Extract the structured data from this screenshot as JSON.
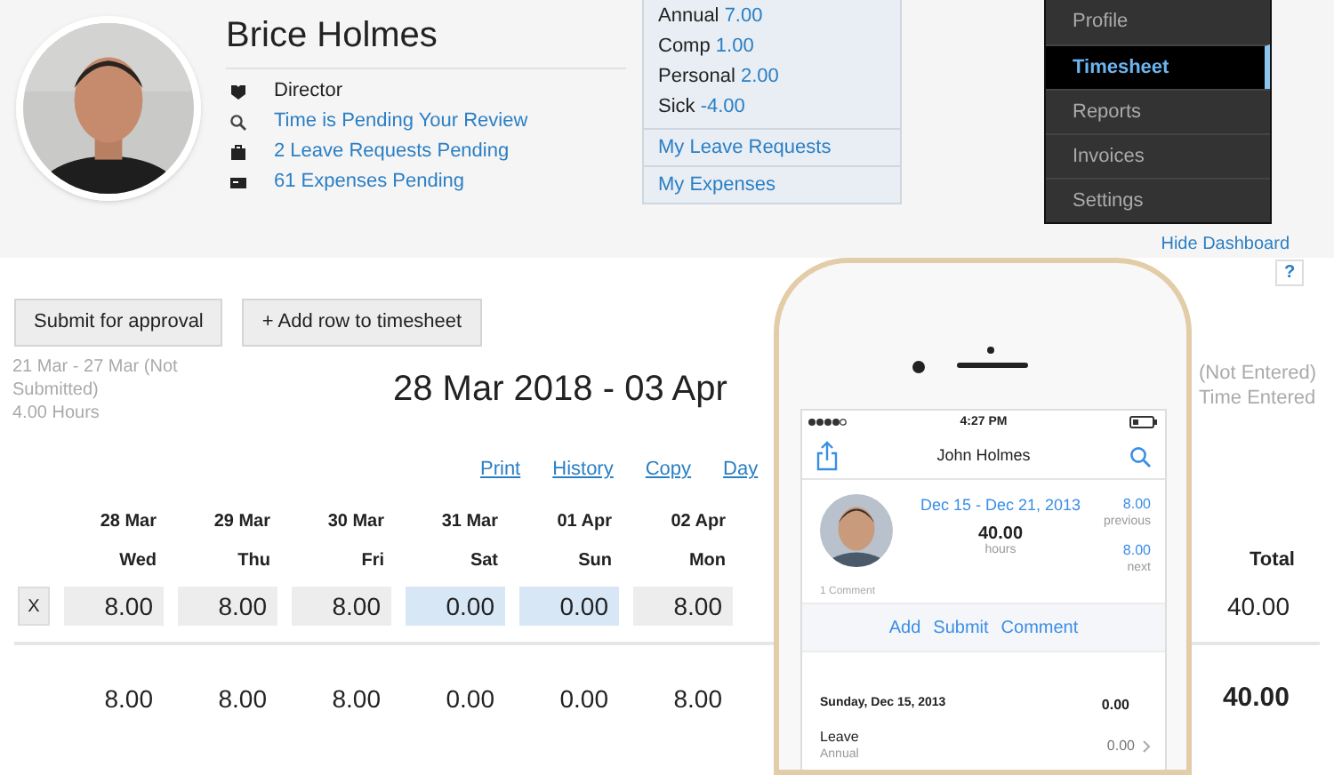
{
  "profile": {
    "name": "Brice Holmes",
    "items": [
      {
        "kind": "text",
        "text": "Director"
      },
      {
        "kind": "link",
        "text": "Time is Pending Your Review"
      },
      {
        "kind": "link",
        "text": "2 Leave Requests Pending"
      },
      {
        "kind": "link",
        "text": "61 Expenses Pending"
      }
    ]
  },
  "leave_balances": [
    {
      "label": "Annual",
      "value": "7.00"
    },
    {
      "label": "Comp",
      "value": "1.00"
    },
    {
      "label": "Personal",
      "value": "2.00"
    },
    {
      "label": "Sick",
      "value": "-4.00"
    }
  ],
  "leave_links": [
    "My Leave Requests",
    "My Expenses"
  ],
  "menu": [
    {
      "label": "Profile",
      "selected": false
    },
    {
      "label": "Timesheet",
      "selected": true
    },
    {
      "label": "Reports",
      "selected": false
    },
    {
      "label": "Invoices",
      "selected": false
    },
    {
      "label": "Settings",
      "selected": false
    }
  ],
  "hide_dashboard": "Hide Dashboard",
  "help": "?",
  "buttons": [
    "Submit for approval",
    "+ Add row to timesheet"
  ],
  "previous_period": [
    "21 Mar - 27 Mar (Not Submitted)",
    "4.00 Hours"
  ],
  "period_title": "28 Mar 2018 - 03 Apr",
  "status_right": [
    "(Not Entered)",
    "Time Entered"
  ],
  "links": [
    "Print",
    "History",
    "Copy",
    "Day"
  ],
  "table": {
    "columns": [
      {
        "date": "28 Mar",
        "day": "Wed"
      },
      {
        "date": "29 Mar",
        "day": "Thu"
      },
      {
        "date": "30 Mar",
        "day": "Fri"
      },
      {
        "date": "31 Mar",
        "day": "Sat"
      },
      {
        "date": "01 Apr",
        "day": "Sun"
      },
      {
        "date": "02 Apr",
        "day": "Mon"
      }
    ],
    "remove": "X",
    "cells": [
      {
        "value": "8.00",
        "kind": "weekday"
      },
      {
        "value": "8.00",
        "kind": "weekday"
      },
      {
        "value": "8.00",
        "kind": "weekday"
      },
      {
        "value": "0.00",
        "kind": "weekend"
      },
      {
        "value": "0.00",
        "kind": "weekend"
      },
      {
        "value": "8.00",
        "kind": "weekday"
      }
    ],
    "totals": [
      "8.00",
      "8.00",
      "8.00",
      "0.00",
      "0.00",
      "8.00"
    ],
    "total_header": "Total",
    "row_total": "40.00",
    "grand_total": "40.00"
  },
  "phone": {
    "time": "4:27 PM",
    "title": "John Holmes",
    "period": "Dec 15 - Dec 21, 2013",
    "hours": "40.00",
    "hours_label": "hours",
    "previous": "8.00",
    "previous_label": "previous",
    "next": "8.00",
    "next_label": "next",
    "comments": "1 Comment",
    "actions": [
      "Add",
      "Submit",
      "Comment"
    ],
    "day": {
      "date": "Sunday, Dec 15, 2013",
      "total": "0.00"
    },
    "entry": {
      "title": "Leave",
      "subtitle": "Annual",
      "value": "0.00"
    }
  }
}
